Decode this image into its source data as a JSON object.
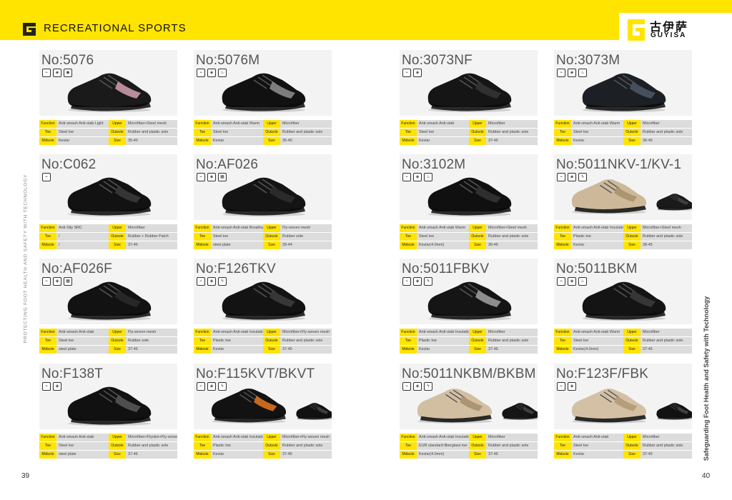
{
  "header": {
    "section_title": "RECREATIONAL SPORTS"
  },
  "logo": {
    "cn": "古伊萨",
    "en": "GUYISA"
  },
  "side": {
    "left": "PROTECTING FOOT HEALTH AND SAFETY WITH TECHNOLOGY",
    "right": "Safeguarding Foot Health and Safety with Technology"
  },
  "pages": {
    "left": "39",
    "right": "40"
  },
  "labels": {
    "function": "Function",
    "upper": "Upper",
    "toe": "Toe",
    "outsole": "Outsole",
    "midsole": "Midsole",
    "size": "Size"
  },
  "colors": {
    "accent": "#ffe400"
  },
  "products": [
    {
      "no": "No:5076",
      "function": "Anti-smash Anti-stab Light",
      "upper": "Microfiber+Steel mesh",
      "toe": "Steel toe",
      "outsole": "Rubber and plastic sole",
      "midsole": "Kevlar",
      "size": "35-40",
      "shoe_color": "#1a1a1a",
      "accent": "#c99aa8",
      "icons": [
        "walk",
        "shield",
        "drop"
      ]
    },
    {
      "no": "No:5076M",
      "function": "Anti-smash Anti-stab Warm",
      "upper": "Microfiber",
      "toe": "Steel toe",
      "outsole": "Rubber and plastic sole",
      "midsole": "Kevlar",
      "size": "35-40",
      "shoe_color": "#111111",
      "accent": "#8a8a8a",
      "icons": [
        "walk",
        "shield",
        "flame"
      ]
    },
    {
      "no": "No:3073NF",
      "function": "Anti-smash Anti-stab",
      "upper": "Microfiber",
      "toe": "Steel toe",
      "outsole": "Rubber and plastic sole",
      "midsole": "Kevlar",
      "size": "37-46",
      "shoe_color": "#151515",
      "accent": "#333333",
      "icons": [
        "walk",
        "shield"
      ]
    },
    {
      "no": "No:3073M",
      "function": "Anti-smash Anti-stab Warm",
      "upper": "Microfiber",
      "toe": "Steel toe",
      "outsole": "Rubber and plastic sole",
      "midsole": "Kevlar",
      "size": "36-46",
      "shoe_color": "#1c1f24",
      "accent": "#4a5563",
      "icons": [
        "walk",
        "shield",
        "flame"
      ]
    },
    {
      "no": "No:C062",
      "function": "Anti-Slip SRC",
      "upper": "Microfiber",
      "toe": "/",
      "outsole": "Rubber + Rubber Patch",
      "midsole": "/",
      "size": "37-45",
      "shoe_color": "#121212",
      "accent": "#3a3a3a",
      "icons": [
        "walk"
      ]
    },
    {
      "no": "No:AF026",
      "function": "Anti-smash Anti-stab Breathable",
      "upper": "Fly-woven mesh",
      "toe": "Steel toe",
      "outsole": "Rubber sole",
      "midsole": "steel plate",
      "size": "39-44",
      "shoe_color": "#141414",
      "accent": "#2c2c2c",
      "icons": [
        "walk",
        "shield",
        "grid"
      ]
    },
    {
      "no": "No:3102M",
      "function": "Anti-smash Anti-stab Warm",
      "upper": "Microfiber+Steel mesh",
      "toe": "Steel toe",
      "outsole": "Rubber and plastic sole",
      "midsole": "Kevlar(4.0mm)",
      "size": "36-46",
      "shoe_color": "#101010",
      "accent": "#333333",
      "icons": [
        "walk",
        "shield",
        "flame"
      ]
    },
    {
      "no": "No:5011NKV-1/KV-1",
      "function": "Anti-smash Anti-stab Insulation 10KV",
      "upper": "Microfiber+Steel mesh",
      "toe": "Plastic toe",
      "outsole": "Rubber and plastic sole",
      "midsole": "Kevlar",
      "size": "38-45",
      "shoe_color": "#cdb99a",
      "accent": "#a8916d",
      "second_color": "#1a1a1a",
      "icons": [
        "walk",
        "shield",
        "bolt"
      ]
    },
    {
      "no": "No:AF026F",
      "function": "Anti-smash Anti-stab",
      "upper": "Fly-woven mesh",
      "toe": "Steel toe",
      "outsole": "Rubber sole",
      "midsole": "steel plate",
      "size": "37-45",
      "shoe_color": "#121212",
      "accent": "#2a2a2a",
      "icons": [
        "walk",
        "shield",
        "grid"
      ]
    },
    {
      "no": "No:F126TKV",
      "function": "Anti-smash Anti-stab Insulation 10KV",
      "upper": "Microfiber+Fly-woven mesh",
      "toe": "Plastic toe",
      "outsole": "Rubber and plastic sole",
      "midsole": "Kevlar",
      "size": "37-45",
      "shoe_color": "#131313",
      "accent": "#3c3c3c",
      "icons": [
        "walk",
        "shield",
        "bolt"
      ]
    },
    {
      "no": "No:5011FBKV",
      "function": "Anti-smash Anti-stab Insulation 10KV",
      "upper": "Microfiber",
      "toe": "Plastic toe",
      "outsole": "Rubber and plastic sole",
      "midsole": "Kevlar",
      "size": "37-45",
      "shoe_color": "#151515",
      "accent": "#9a9a9a",
      "icons": [
        "walk",
        "shield",
        "bolt"
      ]
    },
    {
      "no": "No:5011BKM",
      "function": "Anti-smash Anti-stab Warm",
      "upper": "Microfiber",
      "toe": "Steel toe",
      "outsole": "Rubber and plastic sole",
      "midsole": "Kevlar(4.0mm)",
      "size": "37-45",
      "shoe_color": "#141414",
      "accent": "#3a3a3a",
      "icons": [
        "walk",
        "shield",
        "flame"
      ]
    },
    {
      "no": "No:F138T",
      "function": "Anti-smash Anti-stab",
      "upper": "Microfiber+Flyskin+Fly-woven mesh",
      "toe": "Steel toe",
      "outsole": "Rubber and plastic sole",
      "midsole": "steel plate",
      "size": "37-46",
      "shoe_color": "#111111",
      "accent": "#555555",
      "icons": [
        "walk",
        "shield"
      ]
    },
    {
      "no": "No:F115KVT/BKVT",
      "function": "Anti-smash Anti-stab Insulation 10KV",
      "upper": "Microfiber+Fly-woven mesh",
      "toe": "Plastic toe",
      "outsole": "Rubber and plastic sole",
      "midsole": "Kevlar",
      "size": "37-46",
      "shoe_color": "#121212",
      "accent": "#d9731f",
      "second_color": "#111111",
      "icons": [
        "walk",
        "shield",
        "bolt"
      ]
    },
    {
      "no": "No:5011NKBM/BKBM",
      "function": "Anti-smash Anti-stab Insulation 10KV",
      "upper": "Microfiber",
      "toe": "EUR standard fiberglass toe",
      "outsole": "Rubber and plastic sole",
      "midsole": "Kevlar(4.0mm)",
      "size": "37-45",
      "shoe_color": "#d2bfa2",
      "accent": "#a79070",
      "second_color": "#151515",
      "icons": [
        "walk",
        "shield",
        "bolt"
      ]
    },
    {
      "no": "No:F123F/FBK",
      "function": "Anti-smash Anti-stab",
      "upper": "Microfiber",
      "toe": "Steel toe",
      "outsole": "Rubber and plastic sole",
      "midsole": "Kevlar",
      "size": "37-45",
      "shoe_color": "#d4c1a5",
      "accent": "#b09a78",
      "second_color": "#121212",
      "icons": [
        "walk",
        "shield"
      ]
    }
  ]
}
